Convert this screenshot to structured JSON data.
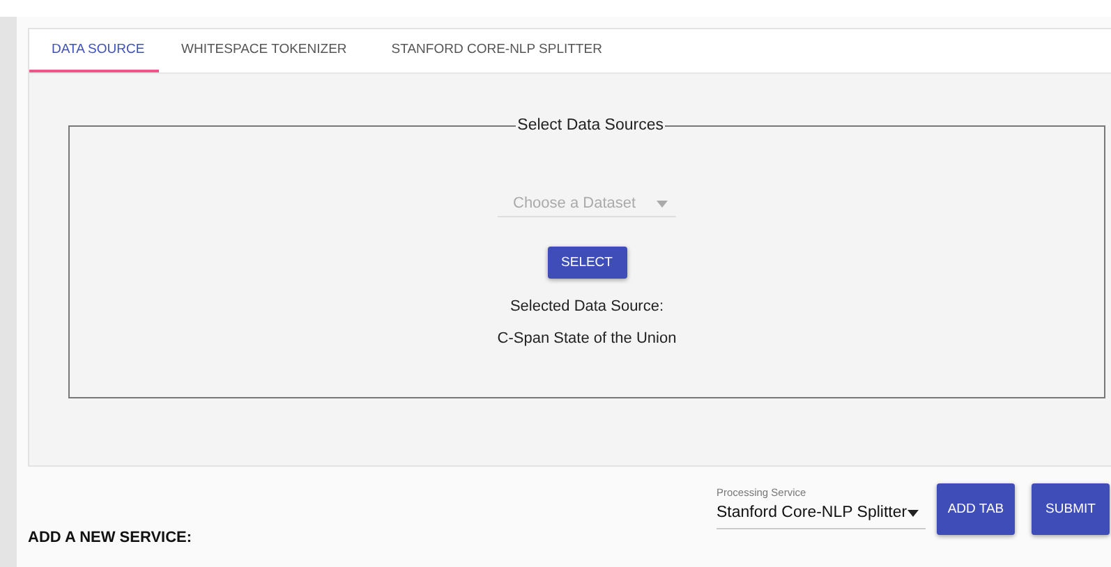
{
  "tabs": [
    {
      "label": "DATA SOURCE",
      "selected": true
    },
    {
      "label": "WHITESPACE TOKENIZER",
      "selected": false
    },
    {
      "label": "STANFORD CORE-NLP SPLITTER",
      "selected": false
    }
  ],
  "data_source": {
    "legend": "Select Data Sources",
    "dataset_select": {
      "placeholder": "Choose a Dataset"
    },
    "select_button": "SELECT",
    "selected_label": "Selected Data Source:",
    "selected_value": "C-Span State of the Union"
  },
  "add_service": {
    "heading": "ADD A NEW SERVICE:",
    "service_select": {
      "label": "Processing Service",
      "value": "Stanford Core-NLP Splitter"
    },
    "buttons": [
      "ADD TAB",
      "SUBMIT"
    ]
  }
}
